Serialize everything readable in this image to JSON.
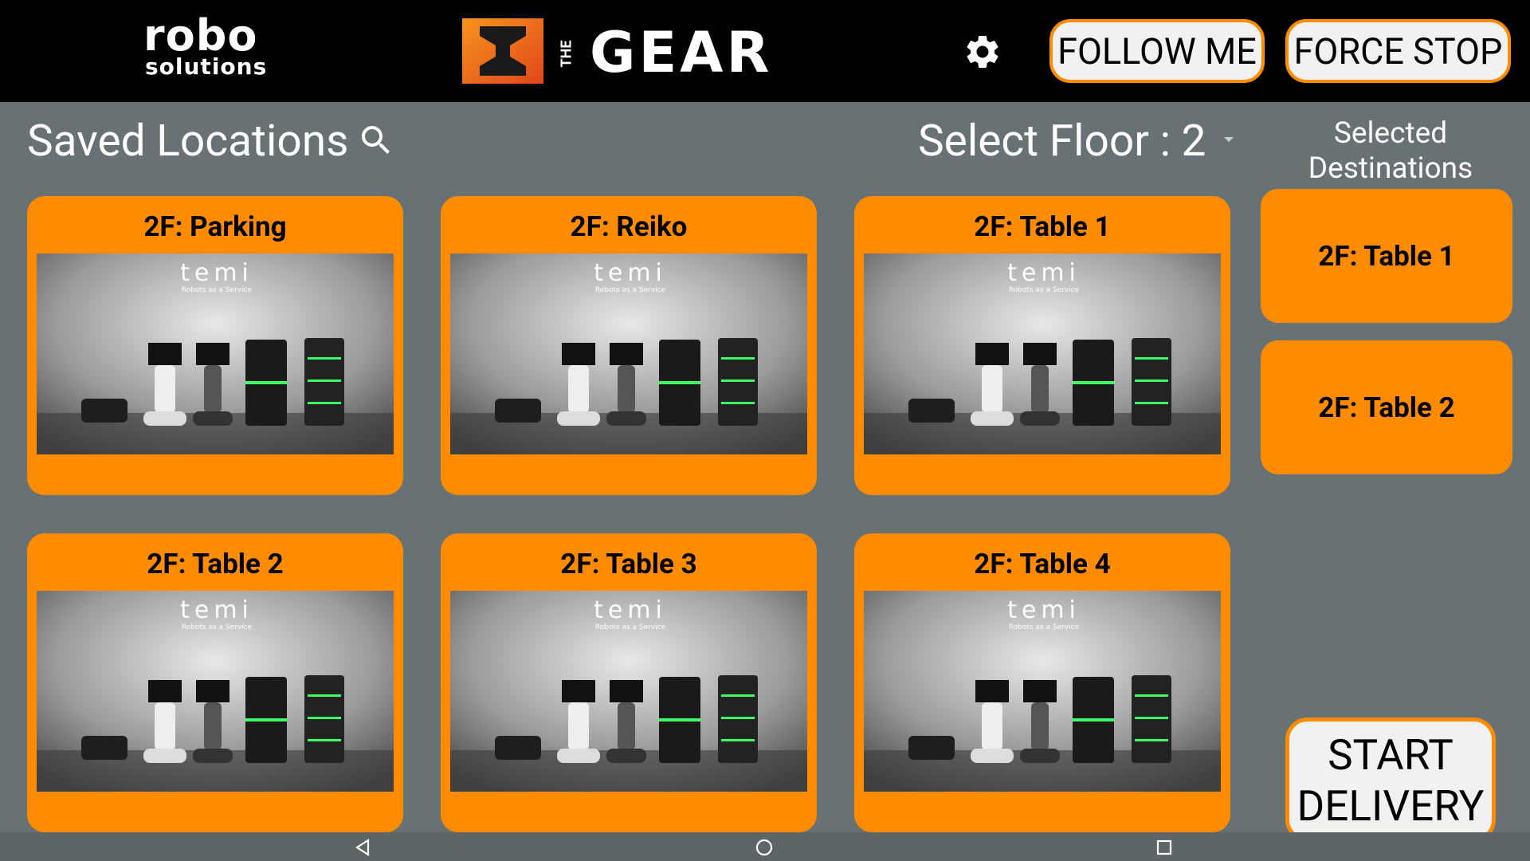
{
  "header": {
    "robo_logo": {
      "line1": "robo",
      "line2": "solutions"
    },
    "gear_logo": {
      "prefix": "THE",
      "word": "GEAR"
    },
    "settings_icon": "gear-icon",
    "follow_me_label": "FOLLOW ME",
    "force_stop_label": "FORCE STOP"
  },
  "saved_locations": {
    "title": "Saved Locations",
    "search_icon": "search-icon",
    "floor_label": "Select Floor : ",
    "floor_value": "2",
    "cards": [
      {
        "label": "2F: Parking",
        "image_text": "temi",
        "image_caption": "Robots as a Service"
      },
      {
        "label": "2F: Reiko",
        "image_text": "temi",
        "image_caption": "Robots as a Service"
      },
      {
        "label": "2F: Table 1",
        "image_text": "temi",
        "image_caption": "Robots as a Service"
      },
      {
        "label": "2F: Table 2",
        "image_text": "temi",
        "image_caption": "Robots as a Service"
      },
      {
        "label": "2F: Table 3",
        "image_text": "temi",
        "image_caption": "Robots as a Service"
      },
      {
        "label": "2F: Table 4",
        "image_text": "temi",
        "image_caption": "Robots as a Service"
      }
    ]
  },
  "selected_destinations": {
    "title": "Selected Destinations",
    "items": [
      "2F: Table 1",
      "2F: Table 2"
    ]
  },
  "start_delivery_label": "START DELIVERY",
  "colors": {
    "accent": "#ff8c00",
    "background": "#687274",
    "topbar": "#000000"
  }
}
